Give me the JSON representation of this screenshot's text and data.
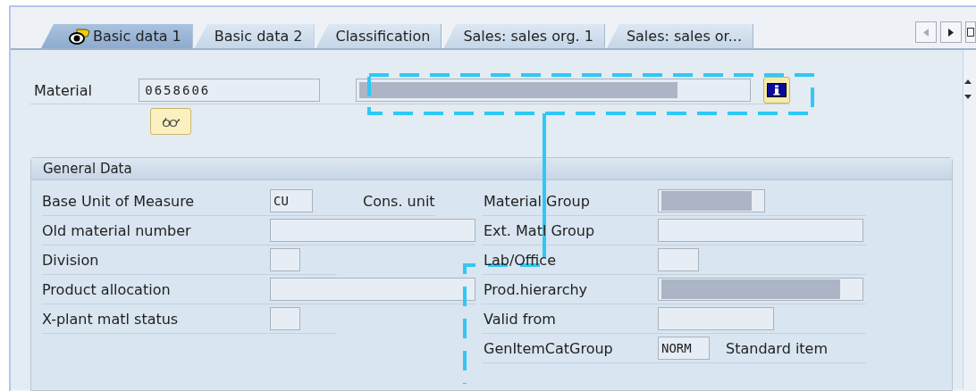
{
  "tabs": [
    {
      "label": "Basic data 1",
      "selected": true,
      "icon": true
    },
    {
      "label": "Basic data 2",
      "selected": false,
      "icon": false
    },
    {
      "label": "Classification",
      "selected": false,
      "icon": false
    },
    {
      "label": "Sales: sales org. 1",
      "selected": false,
      "icon": false
    },
    {
      "label": "Sales: sales or...",
      "selected": false,
      "icon": false
    }
  ],
  "header": {
    "label": "Material",
    "value": "0658606",
    "description_redacted": true
  },
  "group": {
    "title": "General Data",
    "left": [
      {
        "label": "Base Unit of Measure",
        "value": "CU",
        "redacted": false,
        "text": "Cons. unit"
      },
      {
        "label": "Old material number",
        "redacted": false
      },
      {
        "label": "Division",
        "redacted": false
      },
      {
        "label": "Product allocation",
        "redacted": false
      },
      {
        "label": "X-plant matl status",
        "redacted": false
      }
    ],
    "right": [
      {
        "label": "Material Group",
        "redacted": true
      },
      {
        "label": "Ext. Matl Group",
        "redacted": false
      },
      {
        "label": "Lab/Office",
        "redacted": false
      },
      {
        "label": "Prod.hierarchy",
        "redacted": true
      },
      {
        "label": "Valid from",
        "redacted": false
      },
      {
        "label": "GenItemCatGroup",
        "value": "NORM",
        "redacted": false,
        "text": "Standard item"
      }
    ]
  }
}
